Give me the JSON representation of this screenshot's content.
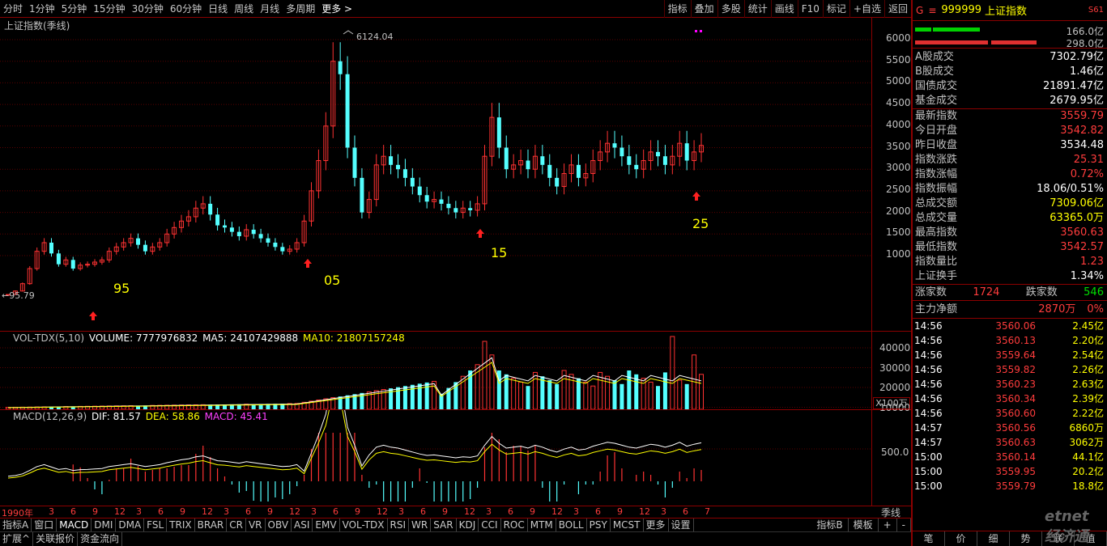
{
  "toolbar": {
    "periods": [
      "分时",
      "1分钟",
      "5分钟",
      "15分钟",
      "30分钟",
      "60分钟",
      "日线",
      "周线",
      "月线",
      "多周期",
      "更多"
    ],
    "right": [
      "指标",
      "叠加",
      "多股",
      "统计",
      "画线",
      "F10",
      "标记",
      "+自选",
      "返回"
    ]
  },
  "main_chart": {
    "title": "上证指数(季线)",
    "high_label": "6124.04",
    "low_label": "95.79",
    "yticks": [
      "6000",
      "5500",
      "5000",
      "4500",
      "4000",
      "3500",
      "3000",
      "2500",
      "2000",
      "1500",
      "1000"
    ],
    "markers": [
      {
        "label": "95",
        "color": "#ffff00"
      },
      {
        "label": "05",
        "color": "#ffff00"
      },
      {
        "label": "15",
        "color": "#ffff00"
      },
      {
        "label": "25",
        "color": "#ffff00"
      }
    ]
  },
  "volume": {
    "label": "VOL-TDX(5,10)",
    "volume_text": "VOLUME: 7777976832",
    "ma5_text": "MA5: 24107429888",
    "ma10_text": "MA10: 21807157248",
    "yticks": [
      "40000",
      "30000",
      "20000",
      "10000"
    ],
    "unit": "X100万"
  },
  "macd": {
    "label": "MACD(12,26,9)",
    "dif_text": "DIF: 81.57",
    "dea_text": "DEA: 58.86",
    "macd_text": "MACD: 45.41",
    "ytick": "500.0"
  },
  "time_axis": {
    "labels": [
      "1990年",
      "3",
      "6",
      "9",
      "12",
      "3",
      "6",
      "9",
      "12",
      "3",
      "6",
      "9",
      "12",
      "3",
      "6",
      "9",
      "12",
      "3",
      "6",
      "9",
      "12",
      "3",
      "6",
      "9",
      "12",
      "3",
      "6",
      "9",
      "12",
      "3",
      "6",
      "7"
    ],
    "period": "季线"
  },
  "bottom_tabs": [
    "指标A",
    "窗口",
    "MACD",
    "DMI",
    "DMA",
    "FSL",
    "TRIX",
    "BRAR",
    "CR",
    "VR",
    "OBV",
    "ASI",
    "EMV",
    "VOL-TDX",
    "RSI",
    "WR",
    "SAR",
    "KDJ",
    "CCI",
    "ROC",
    "MTM",
    "BOLL",
    "PSY",
    "MCST",
    "更多",
    "设置"
  ],
  "bottom_right_tabs": [
    "指标B",
    "模板",
    "+",
    "-"
  ],
  "bottom_row2": [
    "扩展^",
    "关联报价",
    "资金流向"
  ],
  "right_panel": {
    "code": "999999",
    "name": "上证指数",
    "tag": "S61",
    "bar_vals": [
      "166.0亿",
      "298.0亿"
    ],
    "stats1": [
      {
        "k": "A股成交",
        "v": "7302.79亿",
        "c": "white"
      },
      {
        "k": "B股成交",
        "v": "1.46亿",
        "c": "white"
      },
      {
        "k": "国债成交",
        "v": "21891.47亿",
        "c": "white"
      },
      {
        "k": "基金成交",
        "v": "2679.95亿",
        "c": "white"
      }
    ],
    "stats2": [
      {
        "k": "最新指数",
        "v": "3559.79",
        "c": "red"
      },
      {
        "k": "今日开盘",
        "v": "3542.82",
        "c": "red"
      },
      {
        "k": "昨日收盘",
        "v": "3534.48",
        "c": "white"
      },
      {
        "k": "指数涨跌",
        "v": "25.31",
        "c": "red"
      },
      {
        "k": "指数涨幅",
        "v": "0.72%",
        "c": "red"
      },
      {
        "k": "指数振幅",
        "v": "18.06/0.51%",
        "c": "white"
      },
      {
        "k": "总成交额",
        "v": "7309.06亿",
        "c": "yellow"
      },
      {
        "k": "总成交量",
        "v": "63365.0万",
        "c": "yellow"
      },
      {
        "k": "最高指数",
        "v": "3560.63",
        "c": "red"
      },
      {
        "k": "最低指数",
        "v": "3542.57",
        "c": "red"
      },
      {
        "k": "指数量比",
        "v": "1.23",
        "c": "red"
      },
      {
        "k": "上证换手",
        "v": "1.34%",
        "c": "white"
      }
    ],
    "up_label": "涨家数",
    "up_count": "1724",
    "down_label": "跌家数",
    "down_count": "546",
    "main_flow_label": "主力净额",
    "main_flow_value": "2870万",
    "main_flow_pct": "0%",
    "ticks": [
      {
        "t": "14:56",
        "p": "3560.06",
        "v": "2.45亿"
      },
      {
        "t": "14:56",
        "p": "3560.13",
        "v": "2.20亿"
      },
      {
        "t": "14:56",
        "p": "3559.64",
        "v": "2.54亿"
      },
      {
        "t": "14:56",
        "p": "3559.82",
        "v": "2.26亿"
      },
      {
        "t": "14:56",
        "p": "3560.23",
        "v": "2.63亿"
      },
      {
        "t": "14:56",
        "p": "3560.34",
        "v": "2.39亿"
      },
      {
        "t": "14:56",
        "p": "3560.60",
        "v": "2.22亿"
      },
      {
        "t": "14:57",
        "p": "3560.56",
        "v": "6860万"
      },
      {
        "t": "14:57",
        "p": "3560.63",
        "v": "3062万"
      },
      {
        "t": "15:00",
        "p": "3560.14",
        "v": "44.1亿"
      },
      {
        "t": "15:00",
        "p": "3559.95",
        "v": "20.2亿"
      },
      {
        "t": "15:00",
        "p": "3559.79",
        "v": "18.8亿"
      }
    ],
    "bottom_tabs": [
      "笔",
      "价",
      "细",
      "势",
      "联",
      "值"
    ],
    "watermark": "etnet 经济通"
  },
  "colors": {
    "up": "#ff3232",
    "down": "#54ffff",
    "grid": "#8b0000",
    "dif": "#ffffff",
    "dea": "#ffff00"
  }
}
